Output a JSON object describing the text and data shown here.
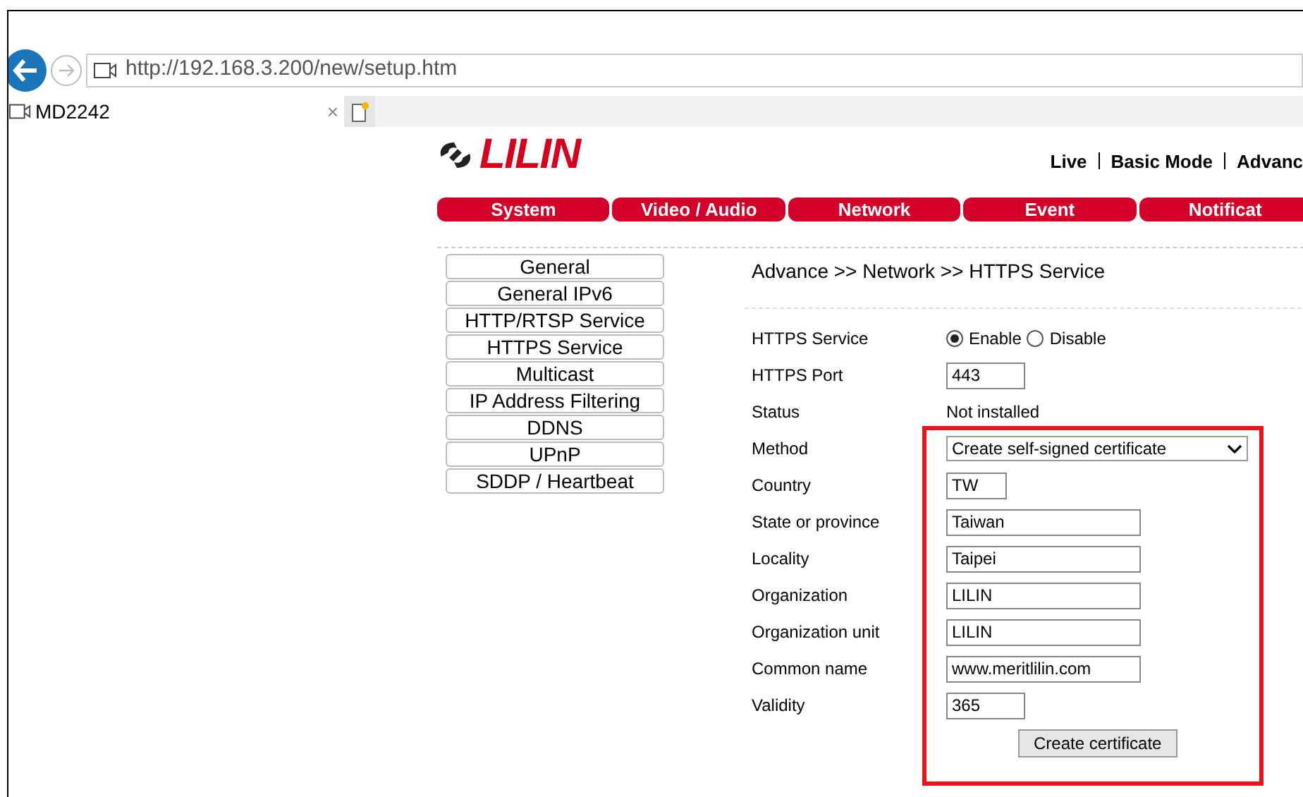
{
  "browser": {
    "address": "http://192.168.3.200/new/setup.htm",
    "tab_title": "MD2242",
    "tab_close": "×"
  },
  "logo": "LILIN",
  "top_links": [
    "Live",
    "Basic Mode",
    "Advanc"
  ],
  "nav_tabs": [
    {
      "label": "System"
    },
    {
      "label": "Video / Audio"
    },
    {
      "label": "Network"
    },
    {
      "label": "Event"
    },
    {
      "label": "Notificat"
    }
  ],
  "sidebar": {
    "items": [
      {
        "label": "General"
      },
      {
        "label": "General IPv6"
      },
      {
        "label": "HTTP/RTSP Service"
      },
      {
        "label": "HTTPS Service"
      },
      {
        "label": "Multicast"
      },
      {
        "label": "IP Address Filtering"
      },
      {
        "label": "DDNS"
      },
      {
        "label": "UPnP"
      },
      {
        "label": "SDDP / Heartbeat"
      }
    ]
  },
  "breadcrumb": "Advance >> Network >> HTTPS Service",
  "form": [
    {
      "kind": "radio",
      "label": "HTTPS Service",
      "options": [
        {
          "label": "Enable",
          "selected": true
        },
        {
          "label": "Disable",
          "selected": false
        }
      ]
    },
    {
      "kind": "input",
      "label": "HTTPS Port",
      "value": "443"
    },
    {
      "kind": "text",
      "label": "Status",
      "value": "Not installed"
    }
  ],
  "certificate": {
    "highlighted": true,
    "fields": [
      {
        "kind": "select",
        "label": "Method",
        "value": "Create self-signed certificate"
      },
      {
        "kind": "input",
        "label": "Country",
        "value": "TW"
      },
      {
        "kind": "input",
        "label": "State or province",
        "value": "Taiwan"
      },
      {
        "kind": "input",
        "label": "Locality",
        "value": "Taipei"
      },
      {
        "kind": "input",
        "label": "Organization",
        "value": "LILIN"
      },
      {
        "kind": "input",
        "label": "Organization unit",
        "value": "LILIN"
      },
      {
        "kind": "input",
        "label": "Common name",
        "value": "www.meritlilin.com"
      },
      {
        "kind": "input",
        "label": "Validity",
        "value": "365"
      }
    ],
    "button": "Create certificate"
  }
}
